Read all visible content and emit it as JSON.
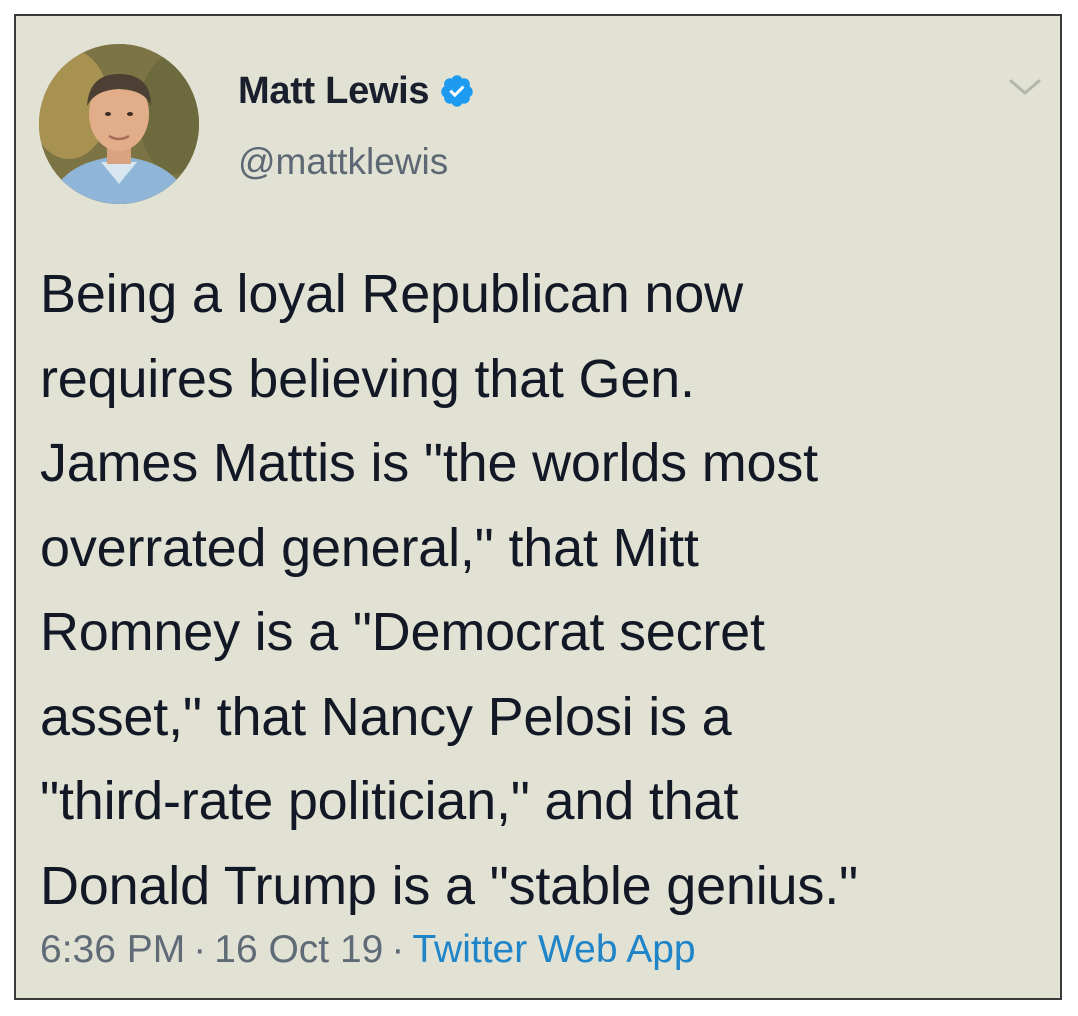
{
  "tweet": {
    "author": {
      "display_name": "Matt Lewis",
      "handle": "@mattklewis",
      "verified": true,
      "avatar_icon": "profile-photo",
      "verified_icon": "verified-badge-icon"
    },
    "menu_icon": "chevron-down-icon",
    "text_lines": [
      "Being a loyal Republican now",
      "requires believing that Gen.",
      "James Mattis is \"the worlds most",
      "overrated general,\"  that Mitt",
      "Romney is a \"Democrat secret",
      "asset,\" that Nancy Pelosi is a",
      "\"third-rate politician,\" and that",
      "Donald Trump is a \"stable genius.\""
    ],
    "meta": {
      "time": "6:36 PM",
      "date": "16 Oct 19",
      "separator": "·",
      "source": "Twitter Web App"
    }
  },
  "colors": {
    "card_background": "#e1e2d3",
    "text": "#121825",
    "secondary_text": "#5d6874",
    "link": "#1f84c8",
    "verified_badge": "#1d9bf0"
  }
}
